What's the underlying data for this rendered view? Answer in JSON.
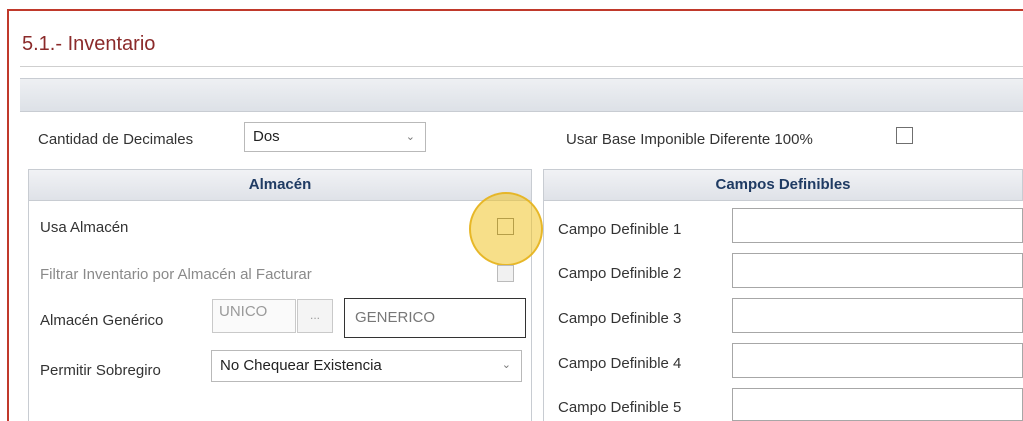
{
  "section": {
    "title": "5.1.- Inventario"
  },
  "general": {
    "decimals_label": "Cantidad de Decimales",
    "decimals_value": "Dos",
    "base_label": "Usar Base Imponible Diferente 100%"
  },
  "almacen": {
    "header": "Almacén",
    "usa_almacen_label": "Usa Almacén",
    "filtrar_label": "Filtrar Inventario por Almacén al Facturar",
    "generico_label": "Almacén Genérico",
    "generico_code": "UNICO",
    "generico_dots": "...",
    "generico_name": "GENERICO",
    "sobregiro_label": "Permitir Sobregiro",
    "sobregiro_value": "No Chequear Existencia"
  },
  "campos": {
    "header": "Campos Definibles",
    "items": [
      {
        "label": "Campo Definible 1",
        "value": ""
      },
      {
        "label": "Campo Definible 2",
        "value": ""
      },
      {
        "label": "Campo Definible 3",
        "value": ""
      },
      {
        "label": "Campo Definible 4",
        "value": ""
      },
      {
        "label": "Campo Definible 5",
        "value": ""
      }
    ]
  },
  "colors": {
    "title": "#8b2a2a",
    "accent_border": "#c0392b",
    "header_text": "#1f3b63",
    "highlight": "#f0c428"
  },
  "icons": {
    "dropdown": "chevron-down-icon"
  }
}
